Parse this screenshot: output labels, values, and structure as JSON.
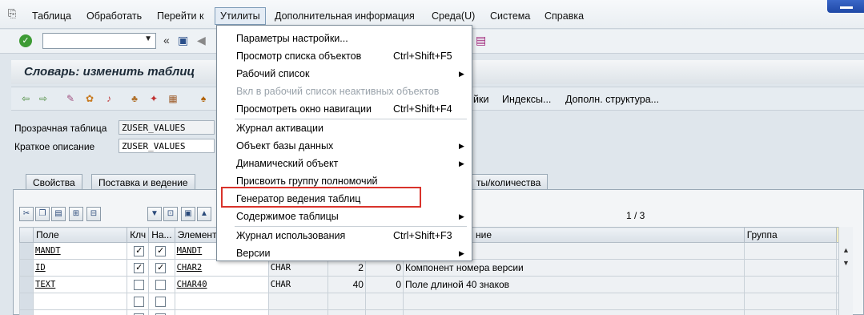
{
  "menubar": {
    "items": [
      "Таблица",
      "Обработать",
      "Перейти к",
      "Утилиты",
      "Дополнительная информация",
      "Среда(U)",
      "Система",
      "Справка"
    ],
    "active": "Утилиты"
  },
  "toolbar": {
    "command_field_value": ""
  },
  "title": "Словарь: изменить таблиц",
  "app_toolbar": {
    "buttons": [
      "йки",
      "Индексы...",
      "Дополн. структура..."
    ]
  },
  "header": {
    "table_label": "Прозрачная таблица",
    "table_value": "ZUSER_VALUES",
    "desc_label": "Краткое описание",
    "desc_value": "ZUSER_VALUES"
  },
  "tabs": [
    "Свойства",
    "Поставка и ведение",
    "ты/количества"
  ],
  "pager": "1 / 3",
  "table": {
    "columns": [
      "Поле",
      "Клч",
      "На...",
      "Элемент",
      "ние",
      "Группа"
    ],
    "rows": [
      {
        "field": "MANDT",
        "key": true,
        "initial": true,
        "element": "MANDT",
        "type": "",
        "len": "",
        "dec": "",
        "desc": ""
      },
      {
        "field": "ID",
        "key": true,
        "initial": true,
        "element": "CHAR2",
        "type": "CHAR",
        "len": "2",
        "dec": "0",
        "desc": "Компонент номера версии"
      },
      {
        "field": "TEXT",
        "key": false,
        "initial": false,
        "element": "CHAR40",
        "type": "CHAR",
        "len": "40",
        "dec": "0",
        "desc": "Поле длиной 40 знаков"
      },
      {
        "field": "",
        "key": false,
        "initial": false,
        "element": "",
        "type": "",
        "len": "",
        "dec": "",
        "desc": ""
      },
      {
        "field": "",
        "key": false,
        "initial": false,
        "element": "",
        "type": "",
        "len": "",
        "dec": "",
        "desc": ""
      }
    ]
  },
  "dropdown": {
    "items": [
      {
        "label": "Параметры настройки...",
        "shortcut": "",
        "submenu": false,
        "disabled": false
      },
      {
        "label": "Просмотр списка объектов",
        "shortcut": "Ctrl+Shift+F5",
        "submenu": false,
        "disabled": false
      },
      {
        "label": "Рабочий список",
        "shortcut": "",
        "submenu": true,
        "disabled": false
      },
      {
        "label": "Вкл в рабочий список неактивных объектов",
        "shortcut": "",
        "submenu": false,
        "disabled": true
      },
      {
        "label": "Просмотреть окно навигации",
        "shortcut": "Ctrl+Shift+F4",
        "submenu": false,
        "disabled": false
      },
      {
        "label": "Журнал активации",
        "shortcut": "",
        "submenu": false,
        "disabled": false
      },
      {
        "label": "Объект базы данных",
        "shortcut": "",
        "submenu": true,
        "disabled": false
      },
      {
        "label": "Динамический объект",
        "shortcut": "",
        "submenu": true,
        "disabled": false
      },
      {
        "label": "Присвоить группу полномочий",
        "shortcut": "",
        "submenu": false,
        "disabled": false
      },
      {
        "label": "Генератор ведения таблиц",
        "shortcut": "",
        "submenu": false,
        "disabled": false
      },
      {
        "label": "Содержимое таблицы",
        "shortcut": "",
        "submenu": true,
        "disabled": false
      },
      {
        "label": "Журнал использования",
        "shortcut": "Ctrl+Shift+F3",
        "submenu": false,
        "disabled": false
      },
      {
        "label": "Версии",
        "shortcut": "",
        "submenu": true,
        "disabled": false
      }
    ],
    "highlighted": "Генератор ведения таблиц"
  },
  "colors": {
    "highlight": "#d9332b",
    "accent": "#3d9b35"
  }
}
